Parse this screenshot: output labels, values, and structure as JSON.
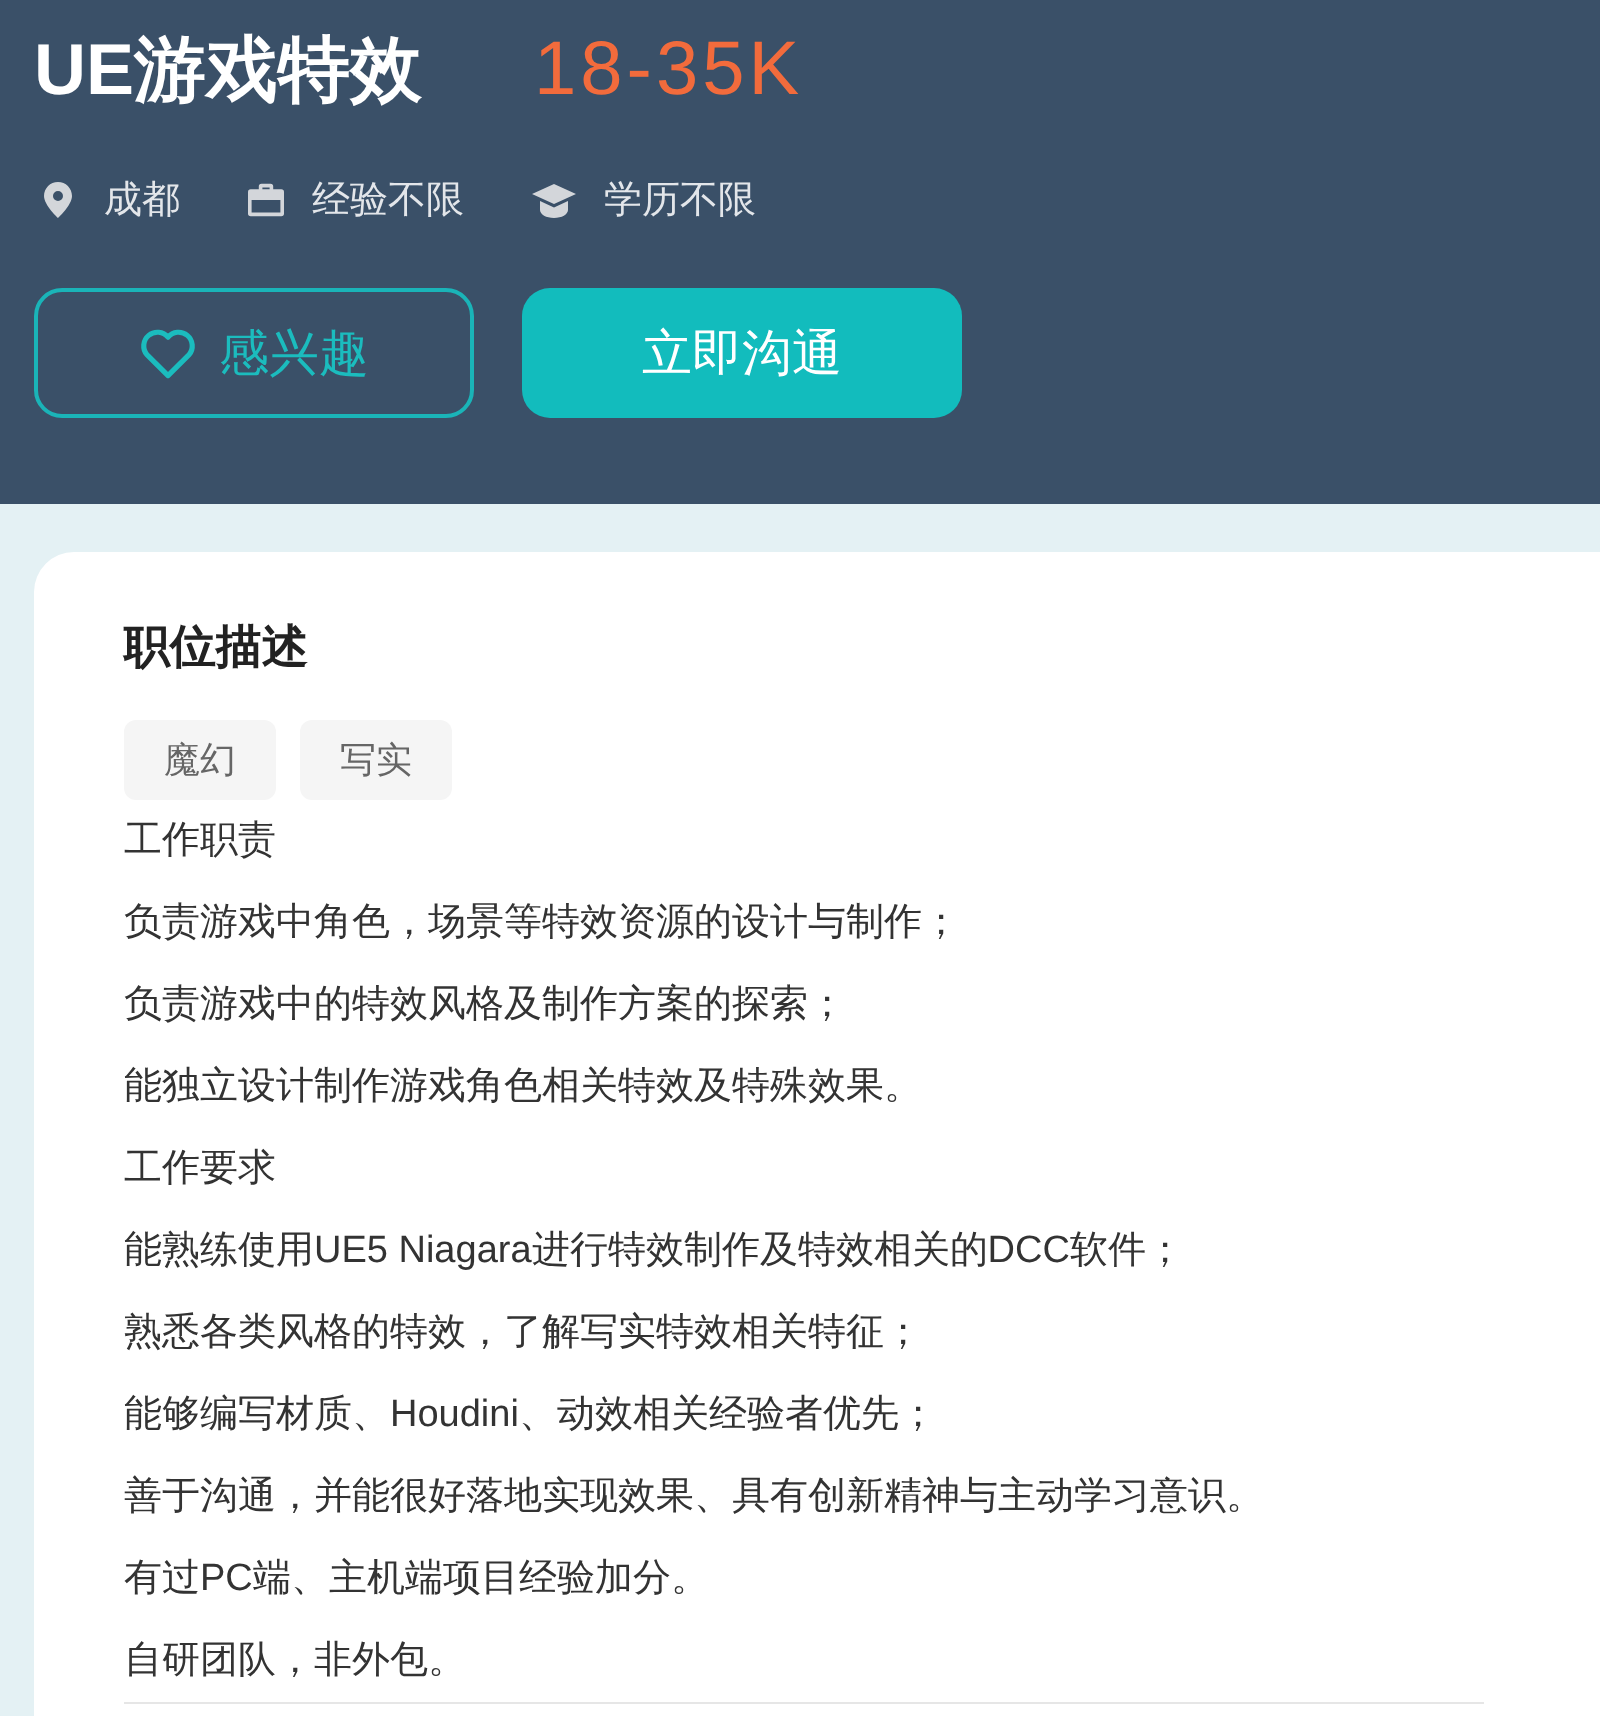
{
  "job": {
    "title": "UE游戏特效",
    "salary": "18-35K",
    "meta": [
      {
        "kind": "location",
        "text": "成都"
      },
      {
        "kind": "experience",
        "text": "经验不限"
      },
      {
        "kind": "education",
        "text": "学历不限"
      }
    ]
  },
  "actions": [
    {
      "kind": "interest",
      "label": "感兴趣"
    },
    {
      "kind": "chat",
      "label": "立即沟通"
    }
  ],
  "description": {
    "heading": "职位描述",
    "tags": [
      "魔幻",
      "写实"
    ],
    "lines": [
      "工作职责",
      "负责游戏中角色，场景等特效资源的设计与制作；",
      "负责游戏中的特效风格及制作方案的探索；",
      "能独立设计制作游戏角色相关特效及特殊效果。",
      "工作要求",
      "能熟练使用UE5 Niagara进行特效制作及特效相关的DCC软件；",
      "熟悉各类风格的特效，了解写实特效相关特征；",
      "能够编写材质、Houdini、动效相关经验者优先；",
      "善于沟通，并能很好落地实现效果、具有创新精神与主动学习意识。",
      "有过PC端、主机端项目经验加分。",
      "自研团队，非外包。"
    ]
  }
}
